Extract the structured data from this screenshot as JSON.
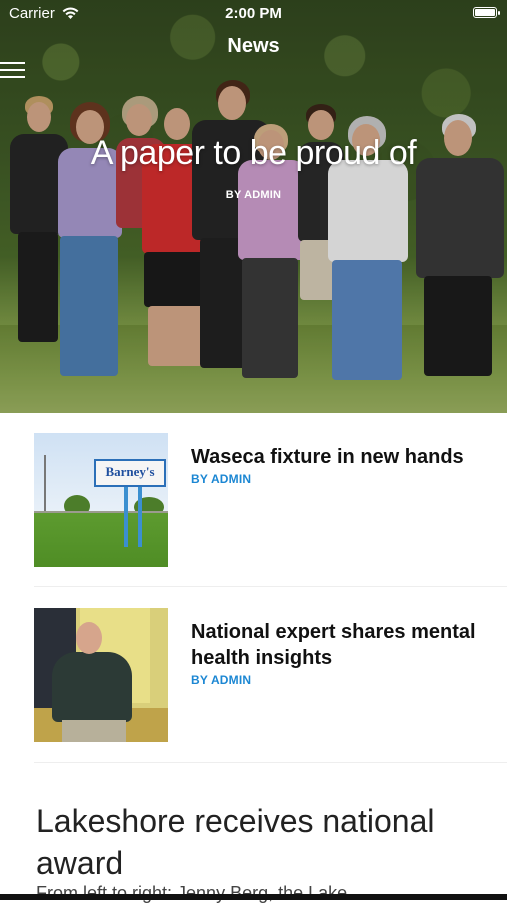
{
  "status_bar": {
    "carrier": "Carrier",
    "time": "2:00 PM",
    "icons": [
      "wifi-icon",
      "battery-icon"
    ]
  },
  "nav": {
    "title": "News",
    "menu_icon": "hamburger-menu-icon"
  },
  "hero": {
    "headline": "A paper to be proud of",
    "author": "BY ADMIN"
  },
  "articles": [
    {
      "title": "Waseca fixture in new hands",
      "author": "BY ADMIN",
      "thumbnail_text": "Barney's"
    },
    {
      "title": "National expert shares mental health insights",
      "author": "BY ADMIN"
    }
  ],
  "feature": {
    "title": "Lakeshore receives national award",
    "excerpt": "From left to right: Jenny Berg, the Lake..."
  },
  "colors": {
    "accent": "#1c87d3",
    "title_text": "#111111"
  }
}
